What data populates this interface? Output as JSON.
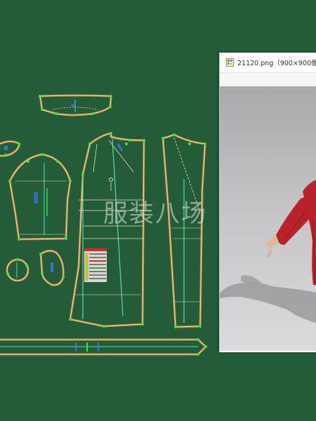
{
  "watermark": {
    "text": "服装八场"
  },
  "preview_window": {
    "title": "21120.png（900×900像素"
  },
  "colors": {
    "background": "#245c3a",
    "seam_outline": "#b5853a",
    "pattern_line": "#e8e0b0",
    "grain_line": "#58d8b8",
    "notch_point": "#39e639",
    "coat": "#b8232b"
  },
  "icons": {
    "app": "image-file-icon"
  }
}
